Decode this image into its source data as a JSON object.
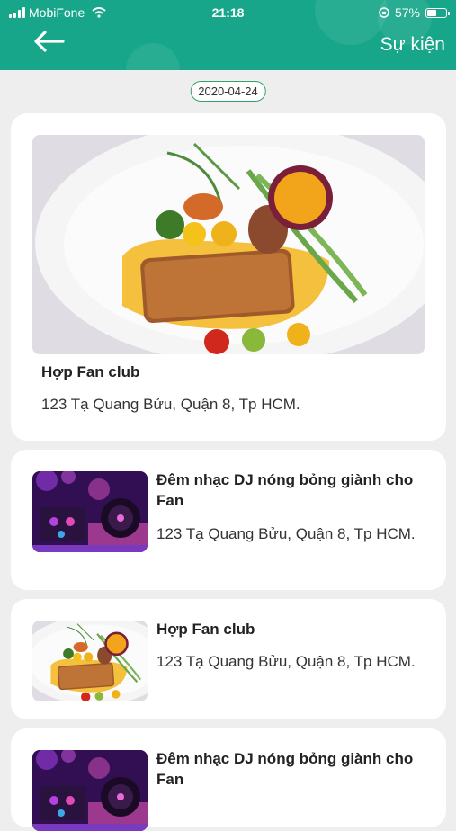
{
  "status_bar": {
    "carrier": "MobiFone",
    "time": "21:18",
    "battery": "57%",
    "battery_level": 0.57
  },
  "header": {
    "title": "Sự kiện",
    "back_icon": "arrow-left-icon",
    "color": "#17a689"
  },
  "date_badge": "2020-04-24",
  "events": [
    {
      "title": "Hợp Fan club",
      "address": "123 Tạ Quang Bửu, Quận 8, Tp HCM.",
      "image": "salmon-dish",
      "featured": true
    },
    {
      "title": "Đêm nhạc DJ nóng bỏng giành cho Fan",
      "address": "123 Tạ Quang Bửu, Quận 8, Tp HCM.",
      "image": "dj-mixer"
    },
    {
      "title": "Hợp Fan club",
      "address": "123 Tạ Quang Bửu, Quận 8, Tp HCM.",
      "image": "salmon-dish"
    },
    {
      "title": "Đêm nhạc DJ nóng bỏng giành cho Fan",
      "address": "",
      "image": "dj-mixer"
    }
  ]
}
